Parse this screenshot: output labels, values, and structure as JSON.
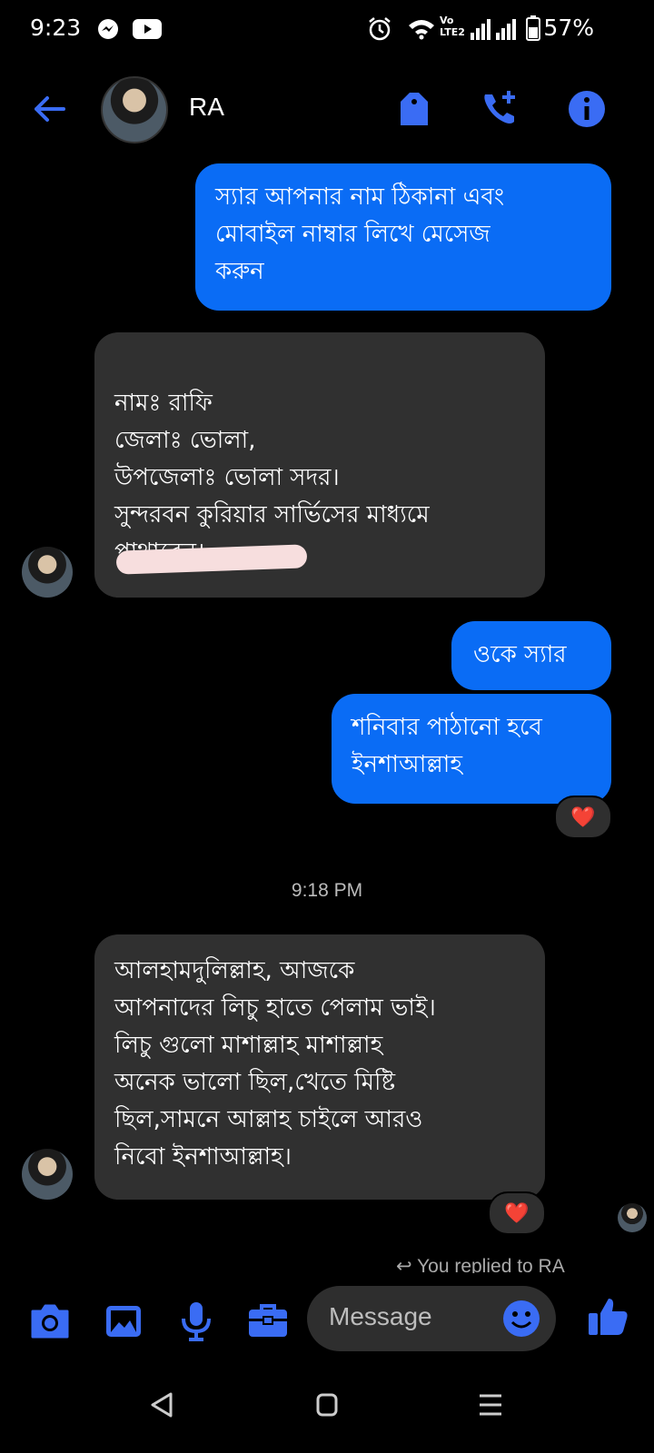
{
  "status_bar": {
    "time": "9:23",
    "battery": "57%",
    "network_label": "Vo LTE2"
  },
  "header": {
    "contact_name": "RA",
    "icons": [
      "back-arrow-icon",
      "tag-icon",
      "add-call-icon",
      "info-icon"
    ]
  },
  "messages": [
    {
      "side": "out",
      "text": "স্যার আপনার নাম ঠিকানা এবং\nমোবাইল নাম্বার লিখে মেসেজ\nকরুন"
    },
    {
      "side": "in",
      "text": "নামঃ রাফি\nজেলাঃ ভোলা,\nউপজেলাঃ ভোলা সদর।\nসুন্দরবন কুরিয়ার সার্ভিসের মাধ্যমে\nপাথাবেন।"
    },
    {
      "side": "out",
      "text": "ওকে স্যার"
    },
    {
      "side": "out",
      "text": "শনিবার পাঠানো হবে\nইনশাআল্লাহ",
      "reaction": "❤️"
    },
    {
      "side": "in",
      "text": "আলহামদুলিল্লাহ,  আজকে\nআপনাদের লিচু হাতে পেলাম ভাই।\nলিচু গুলো মাশাল্লাহ মাশাল্লাহ\nঅনেক ভালো ছিল,খেতে মিষ্টি\nছিল,সামনে আল্লাহ চাইলে আরও\nনিবো ইনশাআল্লাহ।",
      "reaction": "❤️"
    }
  ],
  "timestamp": "9:18 PM",
  "reply_notice": "You replied to RA",
  "composer": {
    "placeholder": "Message",
    "icons": [
      "camera-icon",
      "gallery-icon",
      "mic-icon",
      "briefcase-icon",
      "emoji-icon",
      "thumbs-up-icon"
    ]
  },
  "colors": {
    "accent": "#0a6cf5",
    "icon_blue": "#3a6cf4",
    "incoming_bubble": "#303030",
    "background": "#000000"
  }
}
